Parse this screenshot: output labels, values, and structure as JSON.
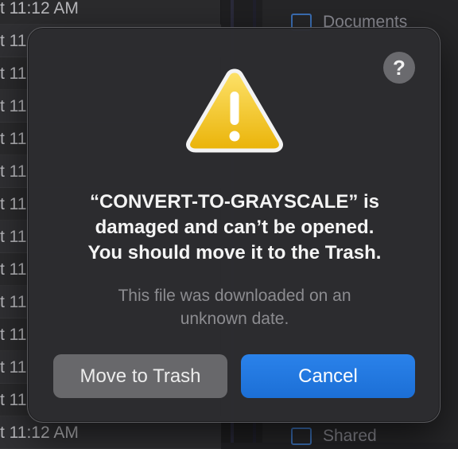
{
  "background": {
    "list_rows": [
      "t 11:12 AM",
      "t 11",
      "t 11",
      "t 11",
      "t 11",
      "t 11",
      "t 11",
      "t 11",
      "t 11",
      "t 11",
      "t 11",
      "t 11",
      "t 11",
      "t 11:12 AM"
    ],
    "sidebar_top": "Documents",
    "sidebar_bottom": "Shared"
  },
  "alert": {
    "help_label": "?",
    "title_lines": [
      "“CONVERT-TO-GRAYSCALE” is",
      "damaged and can’t be opened.",
      "You should move it to the Trash."
    ],
    "message_lines": [
      "This file was downloaded on an",
      "unknown date."
    ],
    "buttons": {
      "move_to_trash": "Move to Trash",
      "cancel": "Cancel"
    },
    "colors": {
      "default_button": "#1c6fd6",
      "secondary_button": "#68686b",
      "warning_yellow": "#f5c518"
    }
  }
}
